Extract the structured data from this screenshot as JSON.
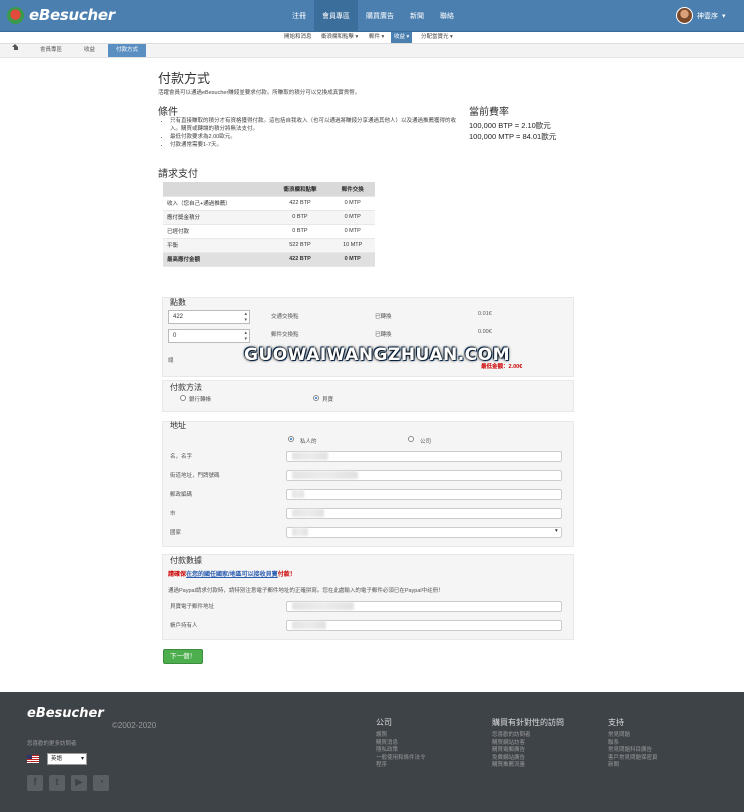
{
  "header": {
    "logo_text": "eBesucher",
    "nav": [
      "注冊",
      "會員專區",
      "購買廣告",
      "新聞",
      "聯絡"
    ],
    "active_nav": 1,
    "user_name": "神壹序"
  },
  "subnav": [
    {
      "label": "開始和消息",
      "active": false
    },
    {
      "label": "衝浪欄和點擊 ▾",
      "active": false
    },
    {
      "label": "郵件 ▾",
      "active": false
    },
    {
      "label": "收益 ▾",
      "active": true
    },
    {
      "label": "分配當寶光 ▾",
      "active": false
    }
  ],
  "breadcrumb": [
    "會員專區",
    "收益",
    "付款方式"
  ],
  "page": {
    "title": "付款方式",
    "intro": "活躍會員可以通過eBesucher賺錢並要求付款。所賺取的積分可以兌換成真實貨幣。",
    "conditions_title": "條件",
    "conditions": [
      "只有直接賺取的積分才有資格獲得付款。這包括自我收入（也可以通過將賺錢分享通過其他人）以及通過推薦獲得的收入。購買或轉讓的積分將無法支付。",
      "最低付款要求為2.00歐元。",
      "付款通常需要1-7天。"
    ],
    "rates_title": "當前費率",
    "rates": [
      "100,000 BTP = 2.10歐元",
      "100,000 MTP = 84.01歐元"
    ],
    "request_title": "請求支付",
    "table": {
      "headers": [
        "",
        "衝浪欄和點擊",
        "郵件交換"
      ],
      "rows": [
        [
          "收入（您自己+通過推薦）",
          "422 BTP",
          "0 MTP"
        ],
        [
          "應付獎金積分",
          "0 BTP",
          "0 MTP"
        ],
        [
          "已經付款",
          "0 BTP",
          "0 MTP"
        ],
        [
          "平衡",
          "522 BTP",
          "10 MTP"
        ],
        [
          "最高應付金額",
          "422 BTP",
          "0 MTP"
        ]
      ]
    }
  },
  "points": {
    "title": "點數",
    "btp_value": "422",
    "mtp_value": "0",
    "btp_label": "交通交換點",
    "mtp_label": "郵件交換點",
    "converted_label": "已轉換",
    "btp_amount": "0.01€",
    "mtp_amount": "0.00€",
    "total_label": "總",
    "min_amount": "最低金額：2.00€"
  },
  "method": {
    "title": "付款方法",
    "options": [
      {
        "label": "銀行轉帳",
        "checked": false
      },
      {
        "label": "貝寶",
        "checked": true
      }
    ]
  },
  "address": {
    "title": "地址",
    "types": [
      {
        "label": "私人的",
        "checked": true
      },
      {
        "label": "公司",
        "checked": false
      }
    ],
    "fields": [
      "名，名字",
      "街道地址，門牌號碼",
      "郵政編碼",
      "市",
      "國家"
    ]
  },
  "payment": {
    "title": "付款數據",
    "warning_prefix": "請確保",
    "warning_link": "在您的國任國家/地區可以接收貝寶",
    "warning_suffix": "付款！",
    "note": "通過Paypal請求付款時，請特別注意電子郵件地址的正確拼寫。您在此處輸入的電子郵件必須已在Paypal中註冊！",
    "fields": [
      "貝寶電子郵件地址",
      "帳戶持有人"
    ],
    "next_button": "下一個！"
  },
  "watermark": "GUOWAIWANGZHUAN.COM",
  "footer": {
    "logo": "eBesucher",
    "copyright": "©2002-2020",
    "note": "您喜歡的更多訪問者",
    "language": "英語",
    "columns": [
      {
        "title": "公司",
        "items": [
          "護照",
          "購買消息",
          "隱私政策",
          "一般使用和條件法令",
          "程序"
        ]
      },
      {
        "title": "購買有針對性的訪問",
        "items": [
          "您喜歡的訪問者",
          "購買網站訪客",
          "購買電郵廣告",
          "免費網站廣告",
          "購買推薦流量"
        ]
      },
      {
        "title": "支持",
        "items": [
          "常見問題",
          "聯系",
          "常見問題科目廣告",
          "客戶常見問題保密頁",
          "新聞"
        ]
      }
    ]
  }
}
